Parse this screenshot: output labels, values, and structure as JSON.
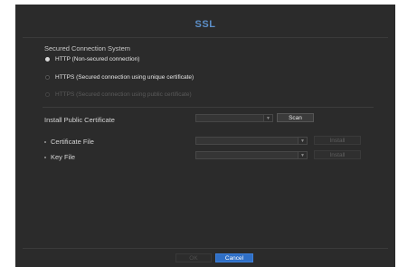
{
  "dialog": {
    "title": "SSL",
    "section_label": "Secured Connection System",
    "options": [
      {
        "label": "HTTP (Non-secured connection)",
        "selected": true,
        "disabled": false
      },
      {
        "label": "HTTPS (Secured connection using unique certificate)",
        "selected": false,
        "disabled": false
      },
      {
        "label": "HTTPS (Secured connection using public certificate)",
        "selected": false,
        "disabled": true
      }
    ],
    "install_public_certificate": {
      "label": "Install Public Certificate",
      "dropdown_value": "",
      "scan_label": "Scan"
    },
    "certificate_file": {
      "label": "Certificate File",
      "dropdown_value": "",
      "install_label": "Install"
    },
    "key_file": {
      "label": "Key File",
      "dropdown_value": "",
      "install_label": "Install"
    },
    "footer": {
      "ok_label": "OK",
      "cancel_label": "Cancel"
    }
  },
  "colors": {
    "accent": "#5c8fc8",
    "primary_button": "#2f6fc6",
    "background": "#2b2b2b"
  }
}
